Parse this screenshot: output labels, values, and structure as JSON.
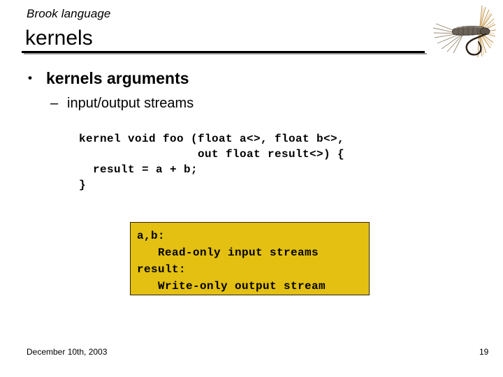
{
  "slide": {
    "background_color": "#ffffff",
    "eyebrow": "Brook language",
    "title": "kernels",
    "page_number": "19",
    "date": "December 10th, 2003"
  },
  "logo": {
    "name": "fishing-fly-logo",
    "alt": "Brook trout fishing fly",
    "hackle_color": "#c79a52",
    "body_color": "#6d6459",
    "hook_color": "#2b2219",
    "wing_color": "#d8ae66"
  },
  "bullets": [
    {
      "level": 1,
      "marker": "•",
      "text": "kernels arguments"
    },
    {
      "level": 2,
      "marker": "–",
      "text": "input/output streams"
    }
  ],
  "code": {
    "language": "brook",
    "text": "kernel void foo (float a<>, float b<>,\n                 out float result<>) {\n  result = a + b;\n}"
  },
  "callout": {
    "background_color": "#e3c011",
    "border_color": "#2b2410",
    "text": "a,b:\n   Read-only input streams\nresult:\n   Write-only output stream"
  }
}
